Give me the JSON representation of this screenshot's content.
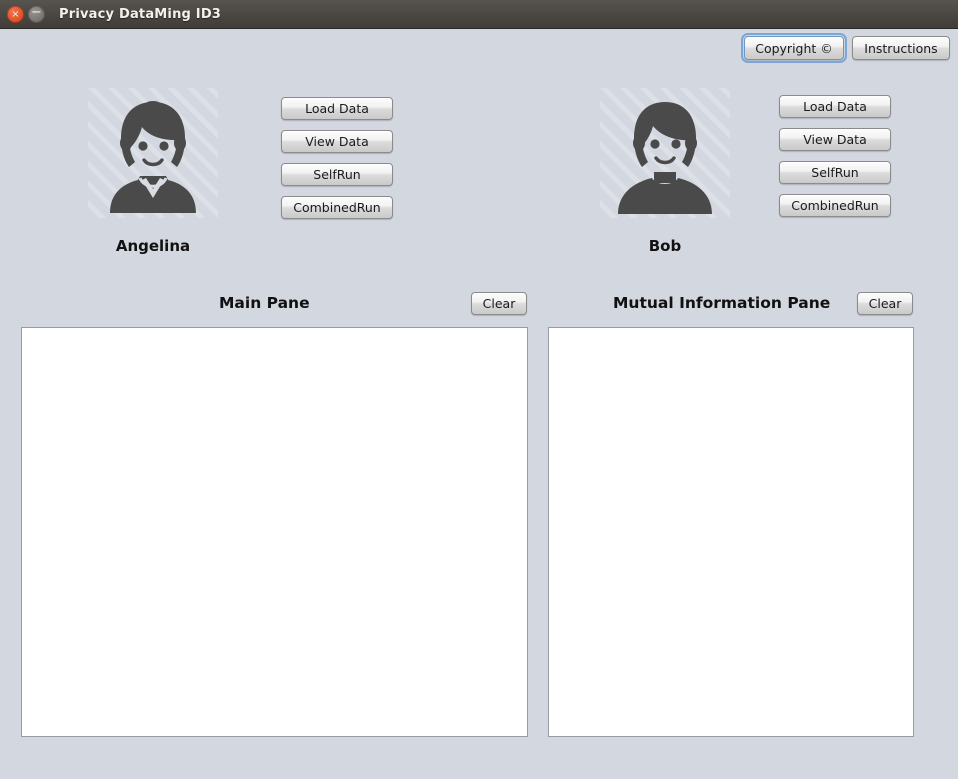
{
  "window": {
    "title": "Privacy DataMing ID3",
    "close_icon": "close-icon",
    "close_glyph": "×",
    "minimize_icon": "minimize-icon",
    "minimize_glyph": "−",
    "titlebar_color": "#4c4945",
    "background_color": "#d3d7df"
  },
  "toolbar": {
    "copyright_label": "Copyright ©",
    "instructions_label": "Instructions",
    "focus_ring_color": "#7aa7d8"
  },
  "people": [
    {
      "name": "Angelina",
      "avatar_icon": "female-avatar-icon",
      "actions": [
        "Load Data",
        "View Data",
        "SelfRun",
        "CombinedRun"
      ]
    },
    {
      "name": "Bob",
      "avatar_icon": "male-avatar-icon",
      "actions": [
        "Load Data",
        "View Data",
        "SelfRun",
        "CombinedRun"
      ]
    }
  ],
  "panes": {
    "main": {
      "title": "Main Pane",
      "clear_label": "Clear",
      "content": ""
    },
    "mutual_information": {
      "title": "Mutual Information Pane",
      "clear_label": "Clear",
      "content": ""
    }
  }
}
